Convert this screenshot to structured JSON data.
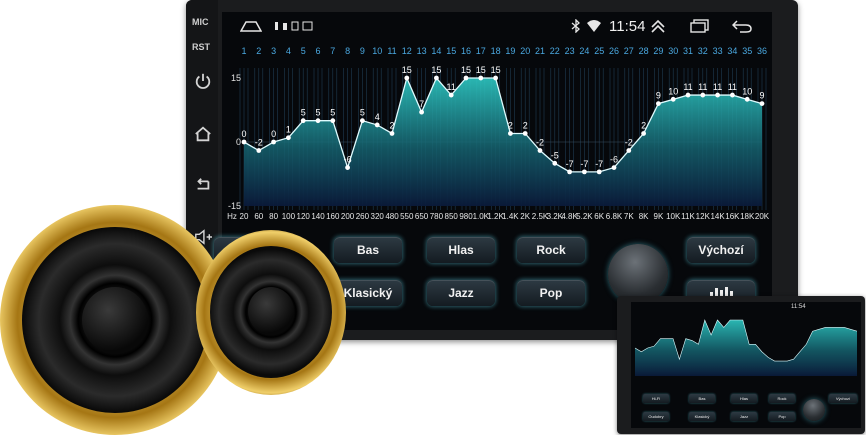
{
  "bezel": {
    "mic_label": "MIC",
    "rst_label": "RST",
    "icons": [
      "power-icon",
      "home-icon",
      "back-icon",
      "volume-up-icon"
    ]
  },
  "statusbar": {
    "time": "11:54",
    "icons": [
      "nav-home-icon",
      "usb-icon",
      "bluetooth-icon",
      "wifi-icon",
      "expand-icon",
      "recent-apps-icon",
      "back-arrow-icon"
    ]
  },
  "eq": {
    "bands": [
      "1",
      "2",
      "3",
      "4",
      "5",
      "6",
      "7",
      "8",
      "9",
      "10",
      "11",
      "12",
      "13",
      "14",
      "15",
      "16",
      "17",
      "18",
      "19",
      "20",
      "21",
      "22",
      "23",
      "24",
      "25",
      "26",
      "27",
      "28",
      "29",
      "30",
      "31",
      "32",
      "33",
      "34",
      "35",
      "36"
    ],
    "values": [
      0,
      -2,
      0,
      1,
      5,
      5,
      5,
      -6,
      5,
      4,
      2,
      15,
      7,
      15,
      11,
      15,
      15,
      15,
      2,
      2,
      -2,
      -5,
      -7,
      -7,
      -7,
      -6,
      -2,
      2,
      9,
      10,
      11,
      11,
      11,
      11,
      10,
      9
    ],
    "frequencies": [
      "20",
      "60",
      "80",
      "100",
      "120",
      "140",
      "160",
      "200",
      "260",
      "320",
      "480",
      "550",
      "650",
      "780",
      "850",
      "980",
      "1.0K",
      "1.2K",
      "1.4K",
      "2K",
      "2.5K",
      "3.2K",
      "4.8K",
      "5.2K",
      "6K",
      "6.8K",
      "7K",
      "8K",
      "9K",
      "10K",
      "11K",
      "12K",
      "14K",
      "16K",
      "18K",
      "20K"
    ],
    "unit_label": "Hz",
    "y_max_label": "15",
    "y_zero_label": "0",
    "y_min_label": "-15",
    "accent": "#2fe0d8"
  },
  "buttons": {
    "bas": "Bas",
    "hlas": "Hlas",
    "rock": "Rock",
    "vychozi": "Výchozí",
    "klasicky": "Klasický",
    "jazz": "Jazz",
    "pop": "Pop"
  },
  "thumbnail": {
    "time": "11:54",
    "hifi": "Hi-Fi",
    "bas": "Bas",
    "hlas": "Hlas",
    "rock": "Rock",
    "vychozi": "Výchozí",
    "oudobry": "Oudobry",
    "klasicky": "Klasický",
    "jazz": "Jazz",
    "pop": "Pop"
  }
}
